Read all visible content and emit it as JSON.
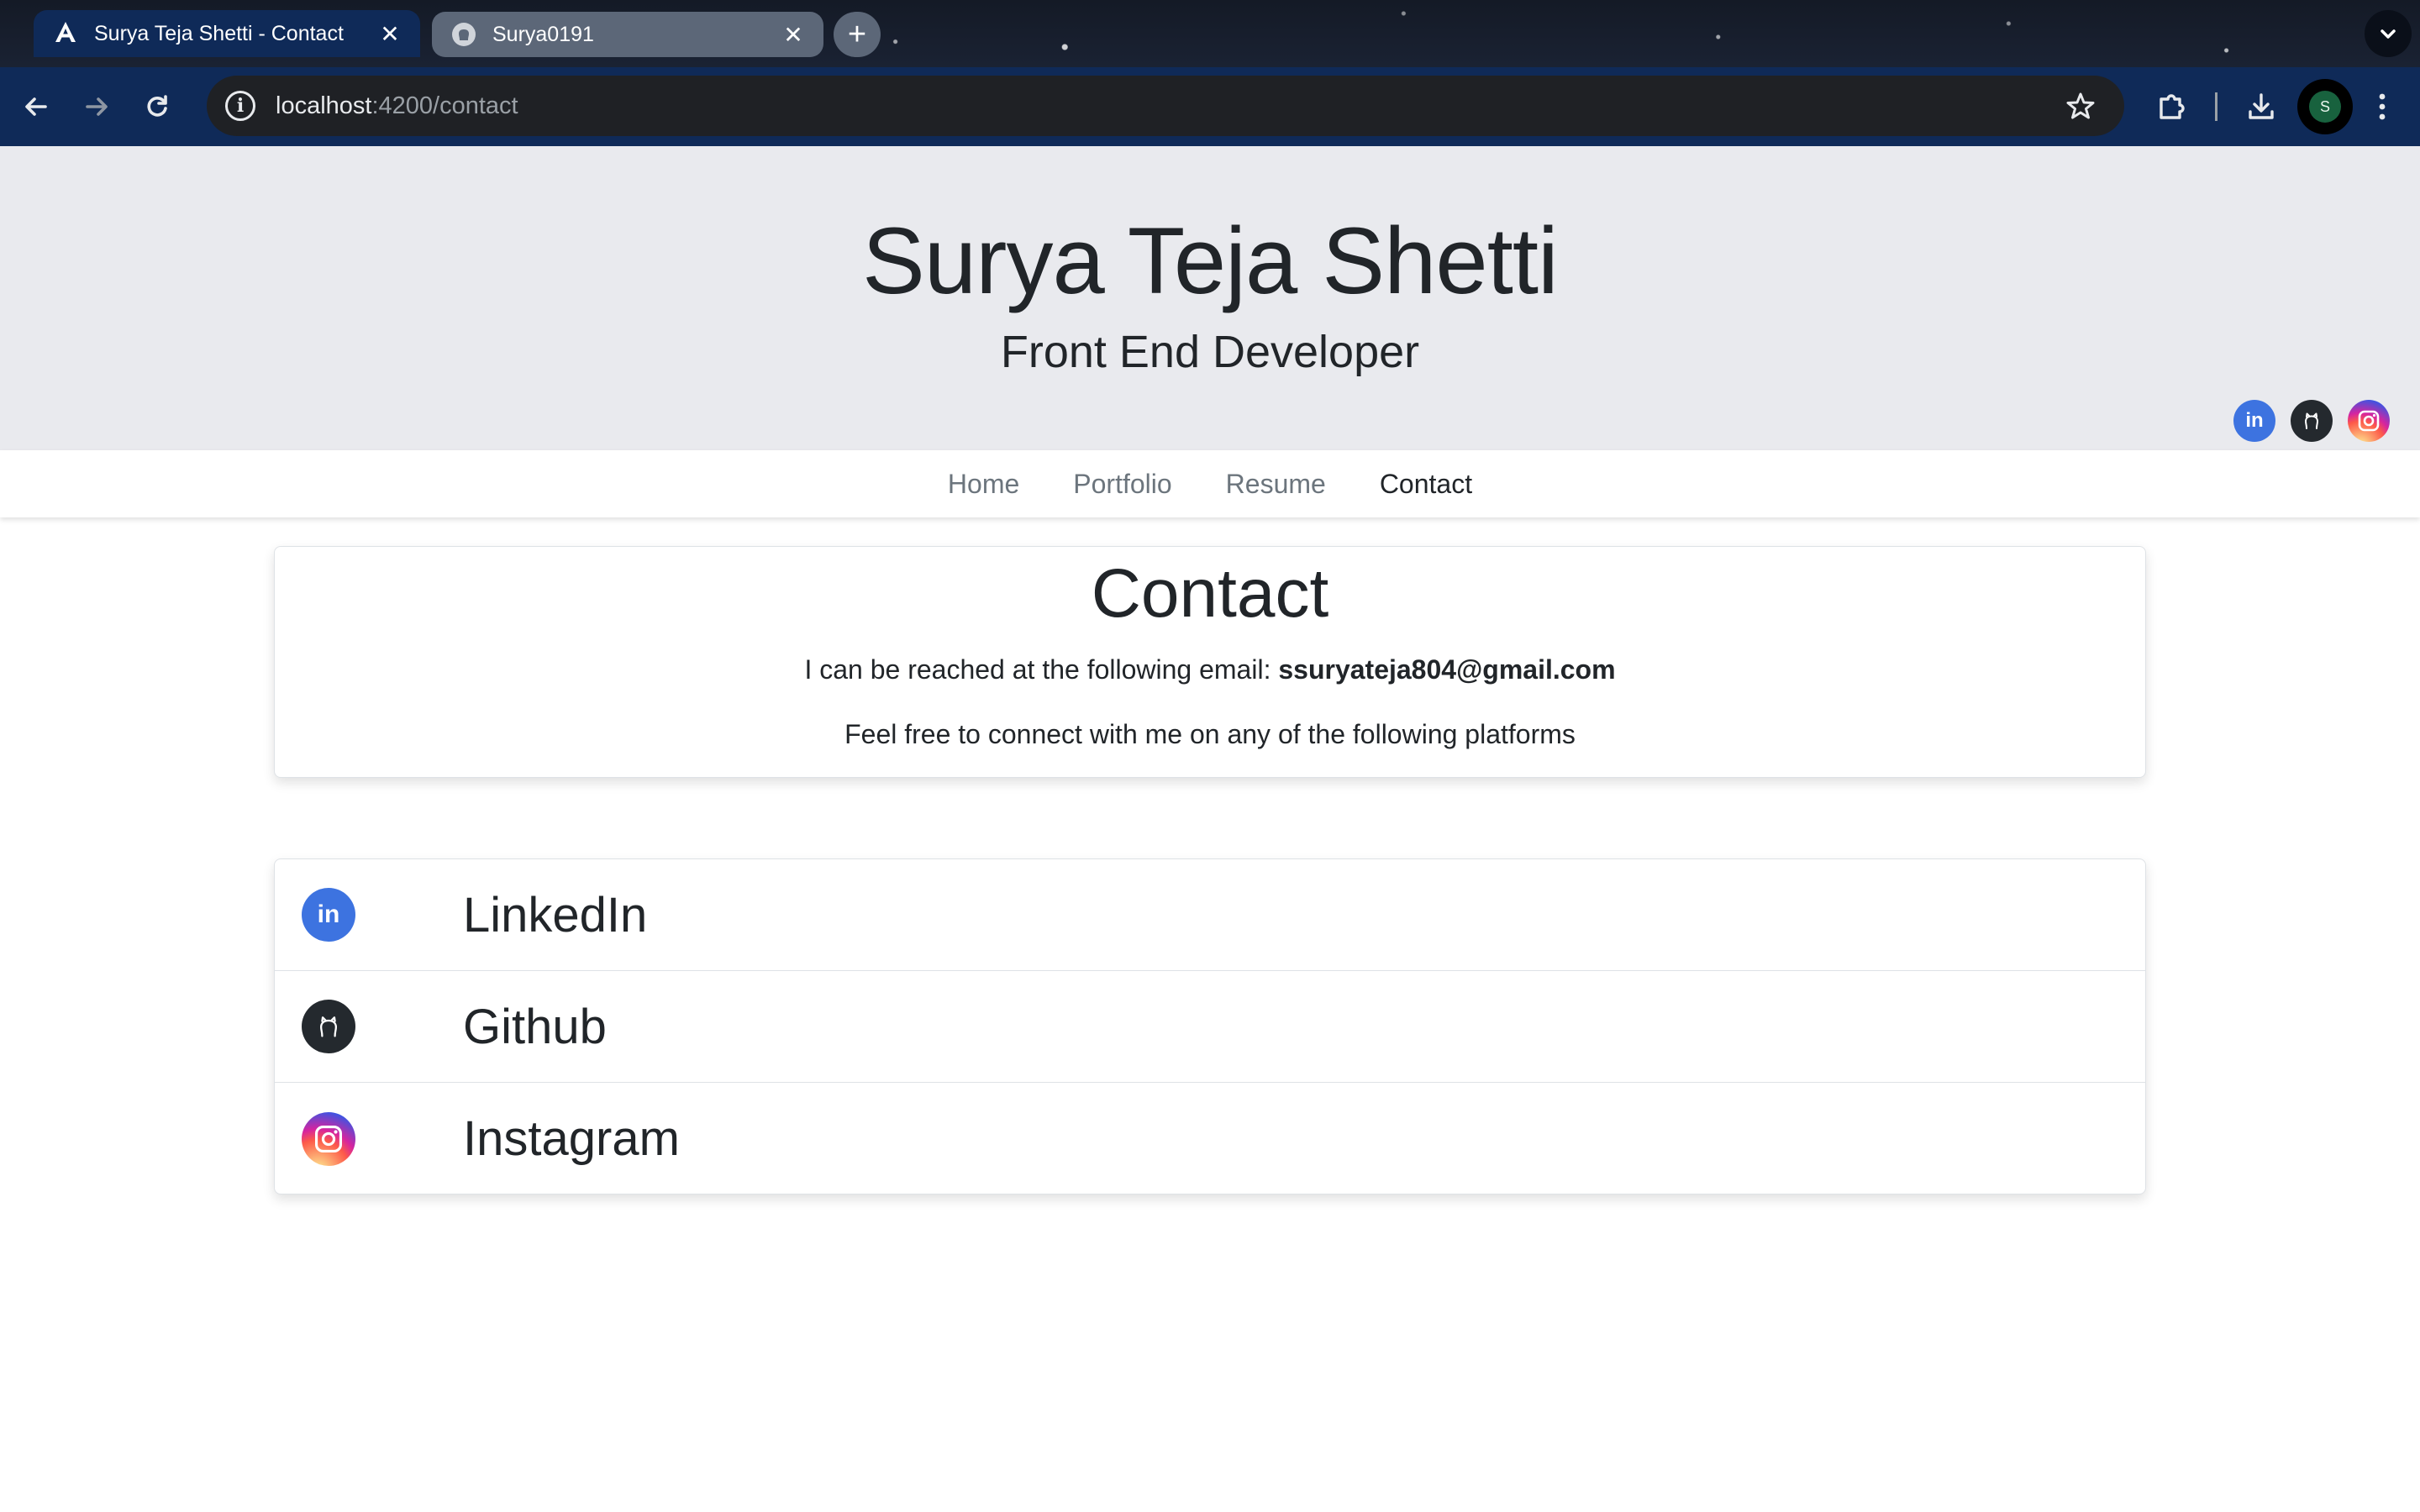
{
  "browser": {
    "tabs": [
      {
        "title": "Surya Teja Shetti - Contact",
        "favicon": "angular-icon",
        "active": true
      },
      {
        "title": "Surya0191",
        "favicon": "github-icon",
        "active": false
      }
    ],
    "url_host": "localhost",
    "url_path": ":4200/contact",
    "profile_initial": "S",
    "colors": {
      "tab_active": "#0f2a58",
      "tab_inactive": "#5c6778",
      "toolbar": "#0f2a58",
      "omnibox": "#1f2125"
    }
  },
  "header": {
    "name": "Surya Teja Shetti",
    "role": "Front End Developer",
    "linkedin_glyph": "in"
  },
  "nav": {
    "items": [
      {
        "label": "Home"
      },
      {
        "label": "Portfolio"
      },
      {
        "label": "Resume"
      },
      {
        "label": "Contact"
      }
    ],
    "active": "Contact"
  },
  "contact": {
    "heading": "Contact",
    "email_prefix": "I can be reached at the following email: ",
    "email": "ssuryateja804@gmail.com",
    "platforms_text": "Feel free to connect with me on any of the following platforms"
  },
  "platforms": [
    {
      "label": "LinkedIn",
      "icon": "linkedin-icon",
      "color": "#3d73e0"
    },
    {
      "label": "Github",
      "icon": "github-icon",
      "color": "#24292e"
    },
    {
      "label": "Instagram",
      "icon": "instagram-icon",
      "color": "#d6249f"
    }
  ]
}
